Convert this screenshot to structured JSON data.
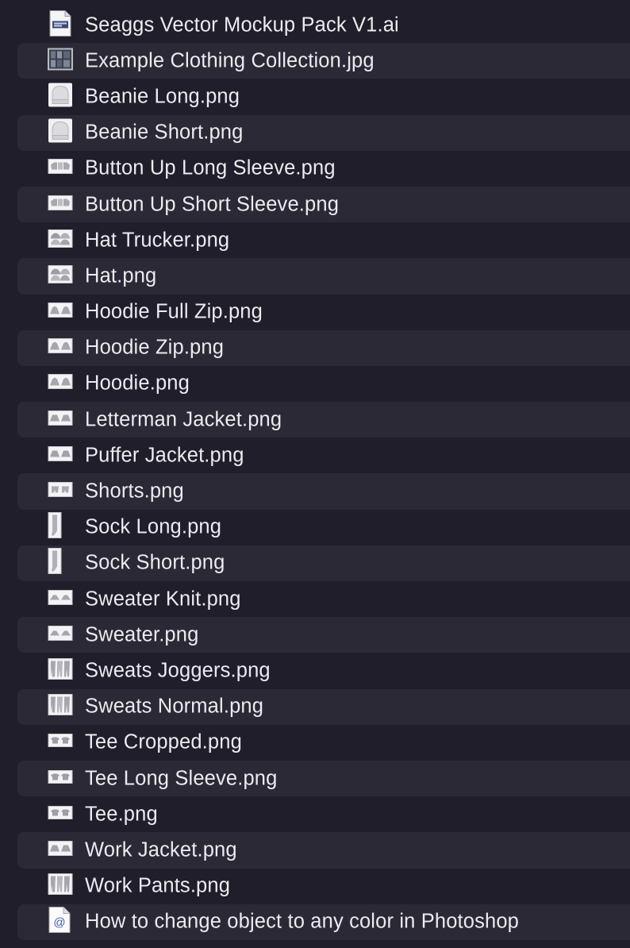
{
  "files": [
    {
      "name": "Seaggs Vector Mockup Pack V1.ai",
      "icon": "ai-file-icon"
    },
    {
      "name": "Example Clothing Collection.jpg",
      "icon": "jpg-collection-icon"
    },
    {
      "name": "Beanie Long.png",
      "icon": "beanie-thumbnail-icon"
    },
    {
      "name": "Beanie Short.png",
      "icon": "beanie-thumbnail-icon"
    },
    {
      "name": "Button Up Long Sleeve.png",
      "icon": "shirt-thumbnail-icon"
    },
    {
      "name": "Button Up Short Sleeve.png",
      "icon": "shirt-thumbnail-icon"
    },
    {
      "name": "Hat Trucker.png",
      "icon": "hat-thumbnail-icon"
    },
    {
      "name": "Hat.png",
      "icon": "hat-thumbnail-icon"
    },
    {
      "name": "Hoodie Full Zip.png",
      "icon": "hoodie-thumbnail-icon"
    },
    {
      "name": "Hoodie Zip.png",
      "icon": "hoodie-thumbnail-icon"
    },
    {
      "name": "Hoodie.png",
      "icon": "hoodie-thumbnail-icon"
    },
    {
      "name": "Letterman Jacket.png",
      "icon": "jacket-thumbnail-icon"
    },
    {
      "name": "Puffer Jacket.png",
      "icon": "jacket-thumbnail-icon"
    },
    {
      "name": "Shorts.png",
      "icon": "shorts-thumbnail-icon"
    },
    {
      "name": "Sock Long.png",
      "icon": "sock-thumbnail-icon"
    },
    {
      "name": "Sock Short.png",
      "icon": "sock-thumbnail-icon"
    },
    {
      "name": "Sweater Knit.png",
      "icon": "sweater-thumbnail-icon"
    },
    {
      "name": "Sweater.png",
      "icon": "sweater-thumbnail-icon"
    },
    {
      "name": "Sweats Joggers.png",
      "icon": "pants-thumbnail-icon"
    },
    {
      "name": "Sweats Normal.png",
      "icon": "pants-thumbnail-icon"
    },
    {
      "name": "Tee Cropped.png",
      "icon": "tee-thumbnail-icon"
    },
    {
      "name": "Tee Long Sleeve.png",
      "icon": "tee-thumbnail-icon"
    },
    {
      "name": "Tee.png",
      "icon": "tee-thumbnail-icon"
    },
    {
      "name": "Work Jacket.png",
      "icon": "jacket-thumbnail-icon"
    },
    {
      "name": "Work Pants.png",
      "icon": "pants-thumbnail-icon"
    },
    {
      "name": "How to change object to any color in Photoshop",
      "icon": "internet-location-icon"
    }
  ],
  "colors": {
    "background": "#1f1e2a",
    "alternate_row": "#2a2935",
    "text": "#ecebf0"
  }
}
